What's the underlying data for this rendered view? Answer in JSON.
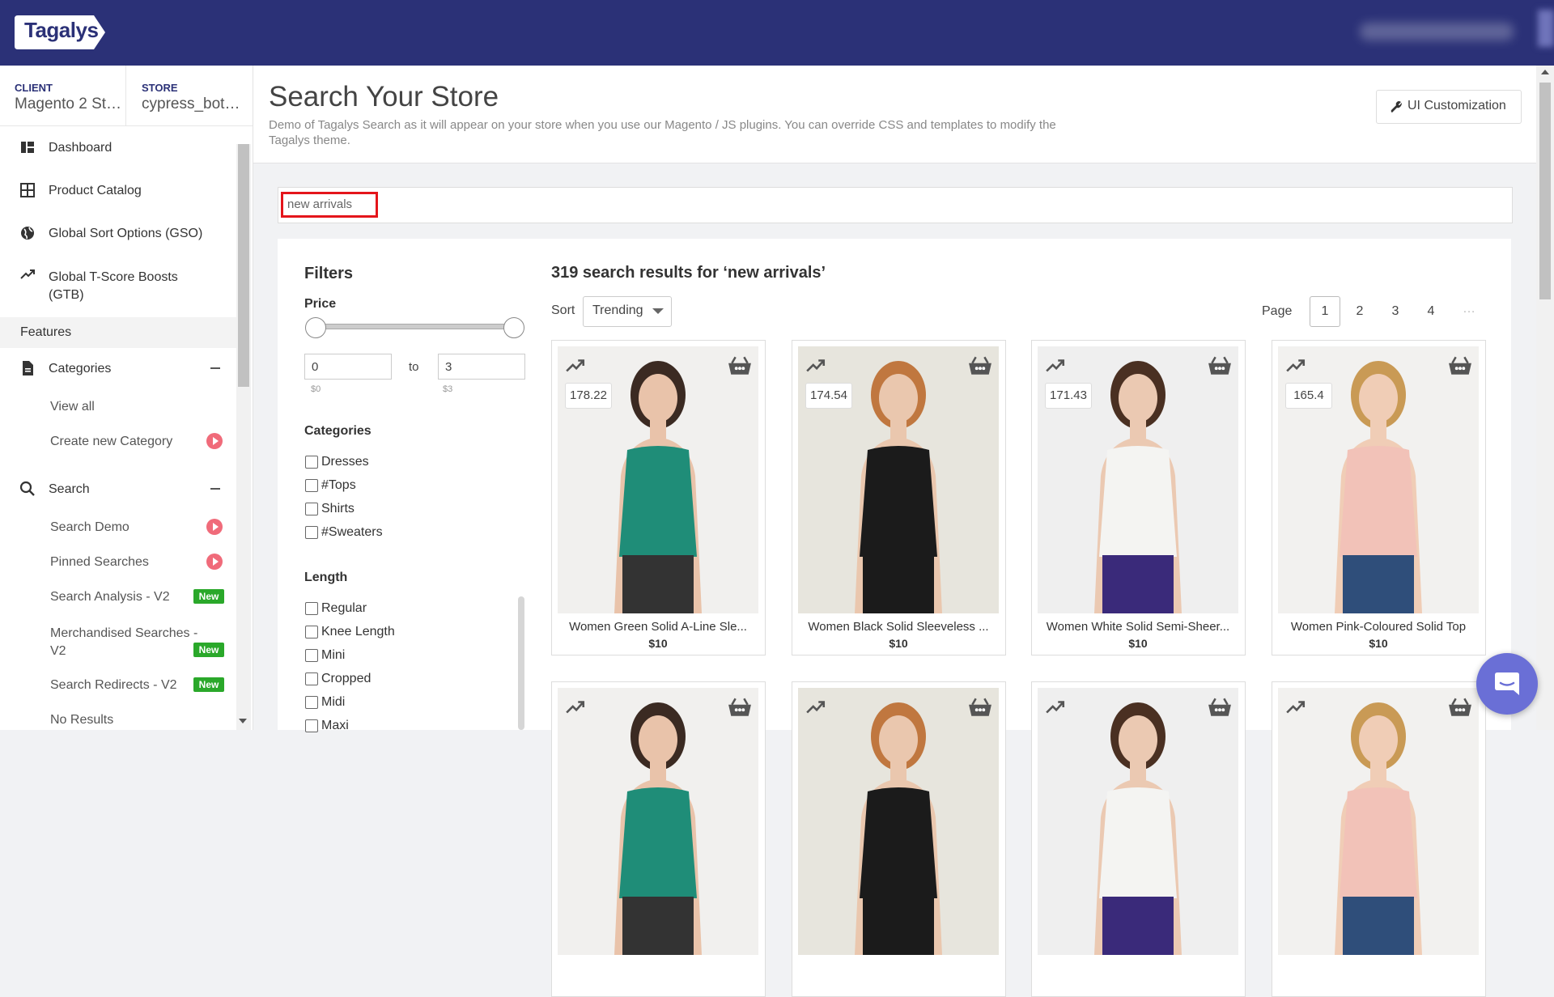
{
  "app": {
    "logo_text": "Tagalys"
  },
  "context": {
    "client_label": "CLIENT",
    "client_value": "Magento 2 Sta...",
    "store_label": "STORE",
    "store_value": "cypress_bot_..."
  },
  "sidebar": {
    "items": [
      {
        "label": "Dashboard",
        "icon": "dashboard-icon"
      },
      {
        "label": "Product Catalog",
        "icon": "grid-icon"
      },
      {
        "label": "Global Sort Options (GSO)",
        "icon": "globe-icon"
      },
      {
        "label": "Global T-Score Boosts (GTB)",
        "icon": "trending-icon"
      }
    ],
    "features_label": "Features",
    "categories": {
      "label": "Categories",
      "icon": "document-icon",
      "sub": [
        {
          "label": "View all"
        },
        {
          "label": "Create new Category",
          "play": true
        }
      ]
    },
    "search": {
      "label": "Search",
      "icon": "search-icon",
      "sub": [
        {
          "label": "Search Demo",
          "play": true
        },
        {
          "label": "Pinned Searches",
          "play": true
        },
        {
          "label": "Search Analysis - V2",
          "badge": "New"
        },
        {
          "label": "Merchandised Searches - V2",
          "badge": "New"
        },
        {
          "label": "Search Redirects - V2",
          "badge": "New"
        },
        {
          "label": "No Results"
        }
      ]
    }
  },
  "page": {
    "title": "Search Your Store",
    "subtitle": "Demo of Tagalys Search as it will appear on your store when you use our Magento / JS plugins. You can override CSS and templates to modify the Tagalys theme.",
    "ui_button": "UI Customization",
    "search_value": "new arrivals"
  },
  "filters": {
    "title": "Filters",
    "price": {
      "label": "Price",
      "min": "0",
      "max": "3",
      "to_label": "to",
      "min_caption": "$0",
      "max_caption": "$3"
    },
    "categories_label": "Categories",
    "categories": [
      "Dresses",
      "#Tops",
      "Shirts",
      "#Sweaters"
    ],
    "length_label": "Length",
    "length": [
      "Regular",
      "Knee Length",
      "Mini",
      "Cropped",
      "Midi",
      "Maxi"
    ]
  },
  "results": {
    "title": "319 search results for ‘new arrivals’",
    "sort_label": "Sort",
    "sort_value": "Trending",
    "page_label": "Page",
    "pages": [
      "1",
      "2",
      "3",
      "4"
    ],
    "active_page": "1",
    "more_pages": "…",
    "products": [
      {
        "name": "Women Green Solid A-Line Sle...",
        "price": "$10",
        "score": "178.22",
        "top": "#1f8d78",
        "bottom": "#333333",
        "bg": "#f1f0ee",
        "skin": "#e9c3aa",
        "hair": "#3b2a22"
      },
      {
        "name": "Women Black Solid Sleeveless ...",
        "price": "$10",
        "score": "174.54",
        "top": "#1b1b1b",
        "bottom": "#1b1b1b",
        "bg": "#e7e5dd",
        "skin": "#eac7ae",
        "hair": "#c0773f"
      },
      {
        "name": "Women White Solid Semi-Sheer...",
        "price": "$10",
        "score": "171.43",
        "top": "#f4f4f2",
        "bottom": "#3a2a7a",
        "bg": "#efefef",
        "skin": "#ebc9b2",
        "hair": "#4a3022"
      },
      {
        "name": "Women Pink-Coloured Solid Top",
        "price": "$10",
        "score": "165.4",
        "top": "#f2c2b8",
        "bottom": "#2f4e7a",
        "bg": "#f2f1ef",
        "skin": "#f0cdb6",
        "hair": "#c99a55"
      }
    ]
  },
  "colors": {
    "brand": "#2b3177",
    "accent_new": "#2aa82a",
    "play": "#f06b7a",
    "highlight": "#e4151b"
  }
}
